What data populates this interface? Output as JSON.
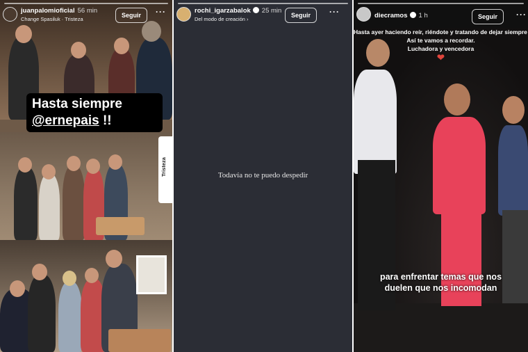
{
  "stories": [
    {
      "username": "juanpalomioficial",
      "time": "56 min",
      "subline": "Change Spasiluk · Tristeza",
      "follow_label": "Seguir",
      "more_label": "···",
      "caption_line1": "Hasta siempre",
      "caption_mention": "@ernepais",
      "caption_suffix": " !!",
      "side_tag": "Tristeza"
    },
    {
      "username": "rochi_igarzabalok",
      "time": "25 min",
      "subline": "Del modo de creación ›",
      "follow_label": "Seguir",
      "more_label": "···",
      "text": "Todavía no te puedo despedir"
    },
    {
      "username": "diecramos",
      "time": "1 h",
      "follow_label": "Seguir",
      "more_label": "···",
      "top_caption_line1": "Hasta ayer haciendo reír, riéndote y tratando de dejar siempre un mensaje p",
      "top_caption_line2": "Así te vamos a recordar.",
      "top_caption_line3": "Luchadora y vencedora",
      "heart": "❤",
      "subtitle_line1": "para enfrentar temas que nos",
      "subtitle_line2": "duelen que nos incomodan"
    }
  ],
  "colors": {
    "dark_panel": "#2b2d35",
    "heart": "#e0453c",
    "pink_suit": "#e8425a"
  }
}
